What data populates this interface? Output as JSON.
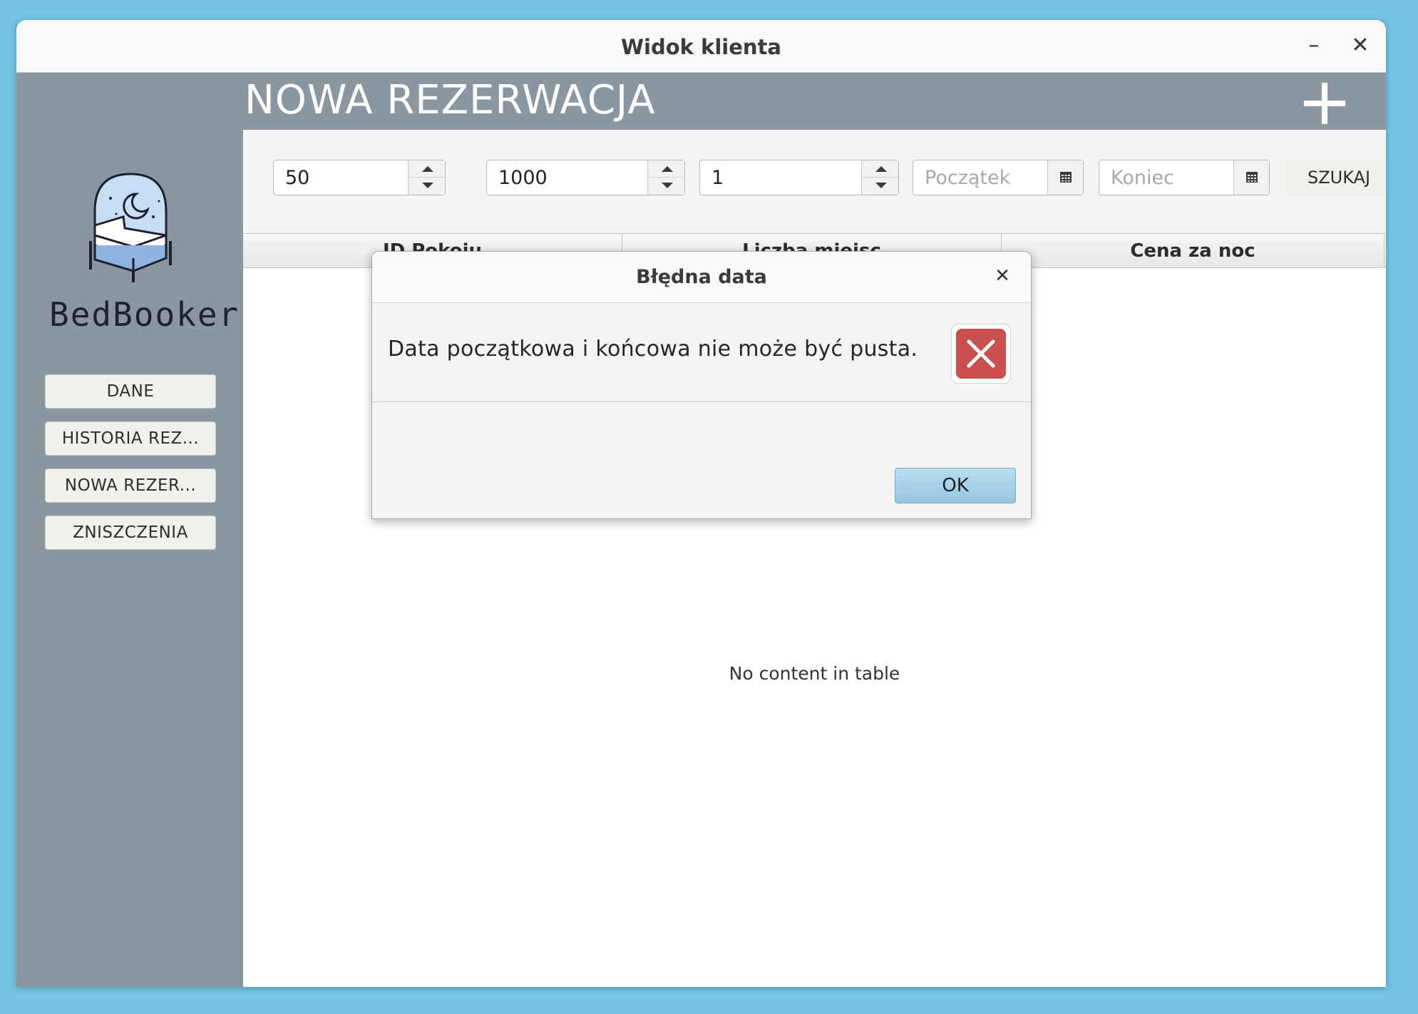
{
  "window": {
    "title": "Widok klienta",
    "minimize_icon": "–",
    "close_icon": "✕"
  },
  "sidebar": {
    "logo_text": "BedBooker",
    "items": [
      {
        "label": "DANE"
      },
      {
        "label": "HISTORIA REZ..."
      },
      {
        "label": "NOWA REZER..."
      },
      {
        "label": "ZNISZCZENIA"
      }
    ]
  },
  "header": {
    "title": "NOWA REZERWACJA"
  },
  "filters": {
    "spinner1_value": "50",
    "spinner2_value": "1000",
    "spinner3_value": "1",
    "start_placeholder": "Początek",
    "end_placeholder": "Koniec",
    "search_label": "SZUKAJ"
  },
  "table": {
    "columns": [
      "ID Pokoju",
      "Liczba miejsc",
      "Cena za noc"
    ],
    "empty_message": "No content in table"
  },
  "dialog": {
    "title": "Błędna data",
    "close_icon": "✕",
    "message": "Data początkowa i końcowa nie może być pusta.",
    "ok_label": "OK"
  },
  "colors": {
    "sidebar_bg": "#8a97a1",
    "desktop_bg": "#74c4e5",
    "error_red": "#cc4f4f",
    "ok_button": "#a7d3ea"
  }
}
